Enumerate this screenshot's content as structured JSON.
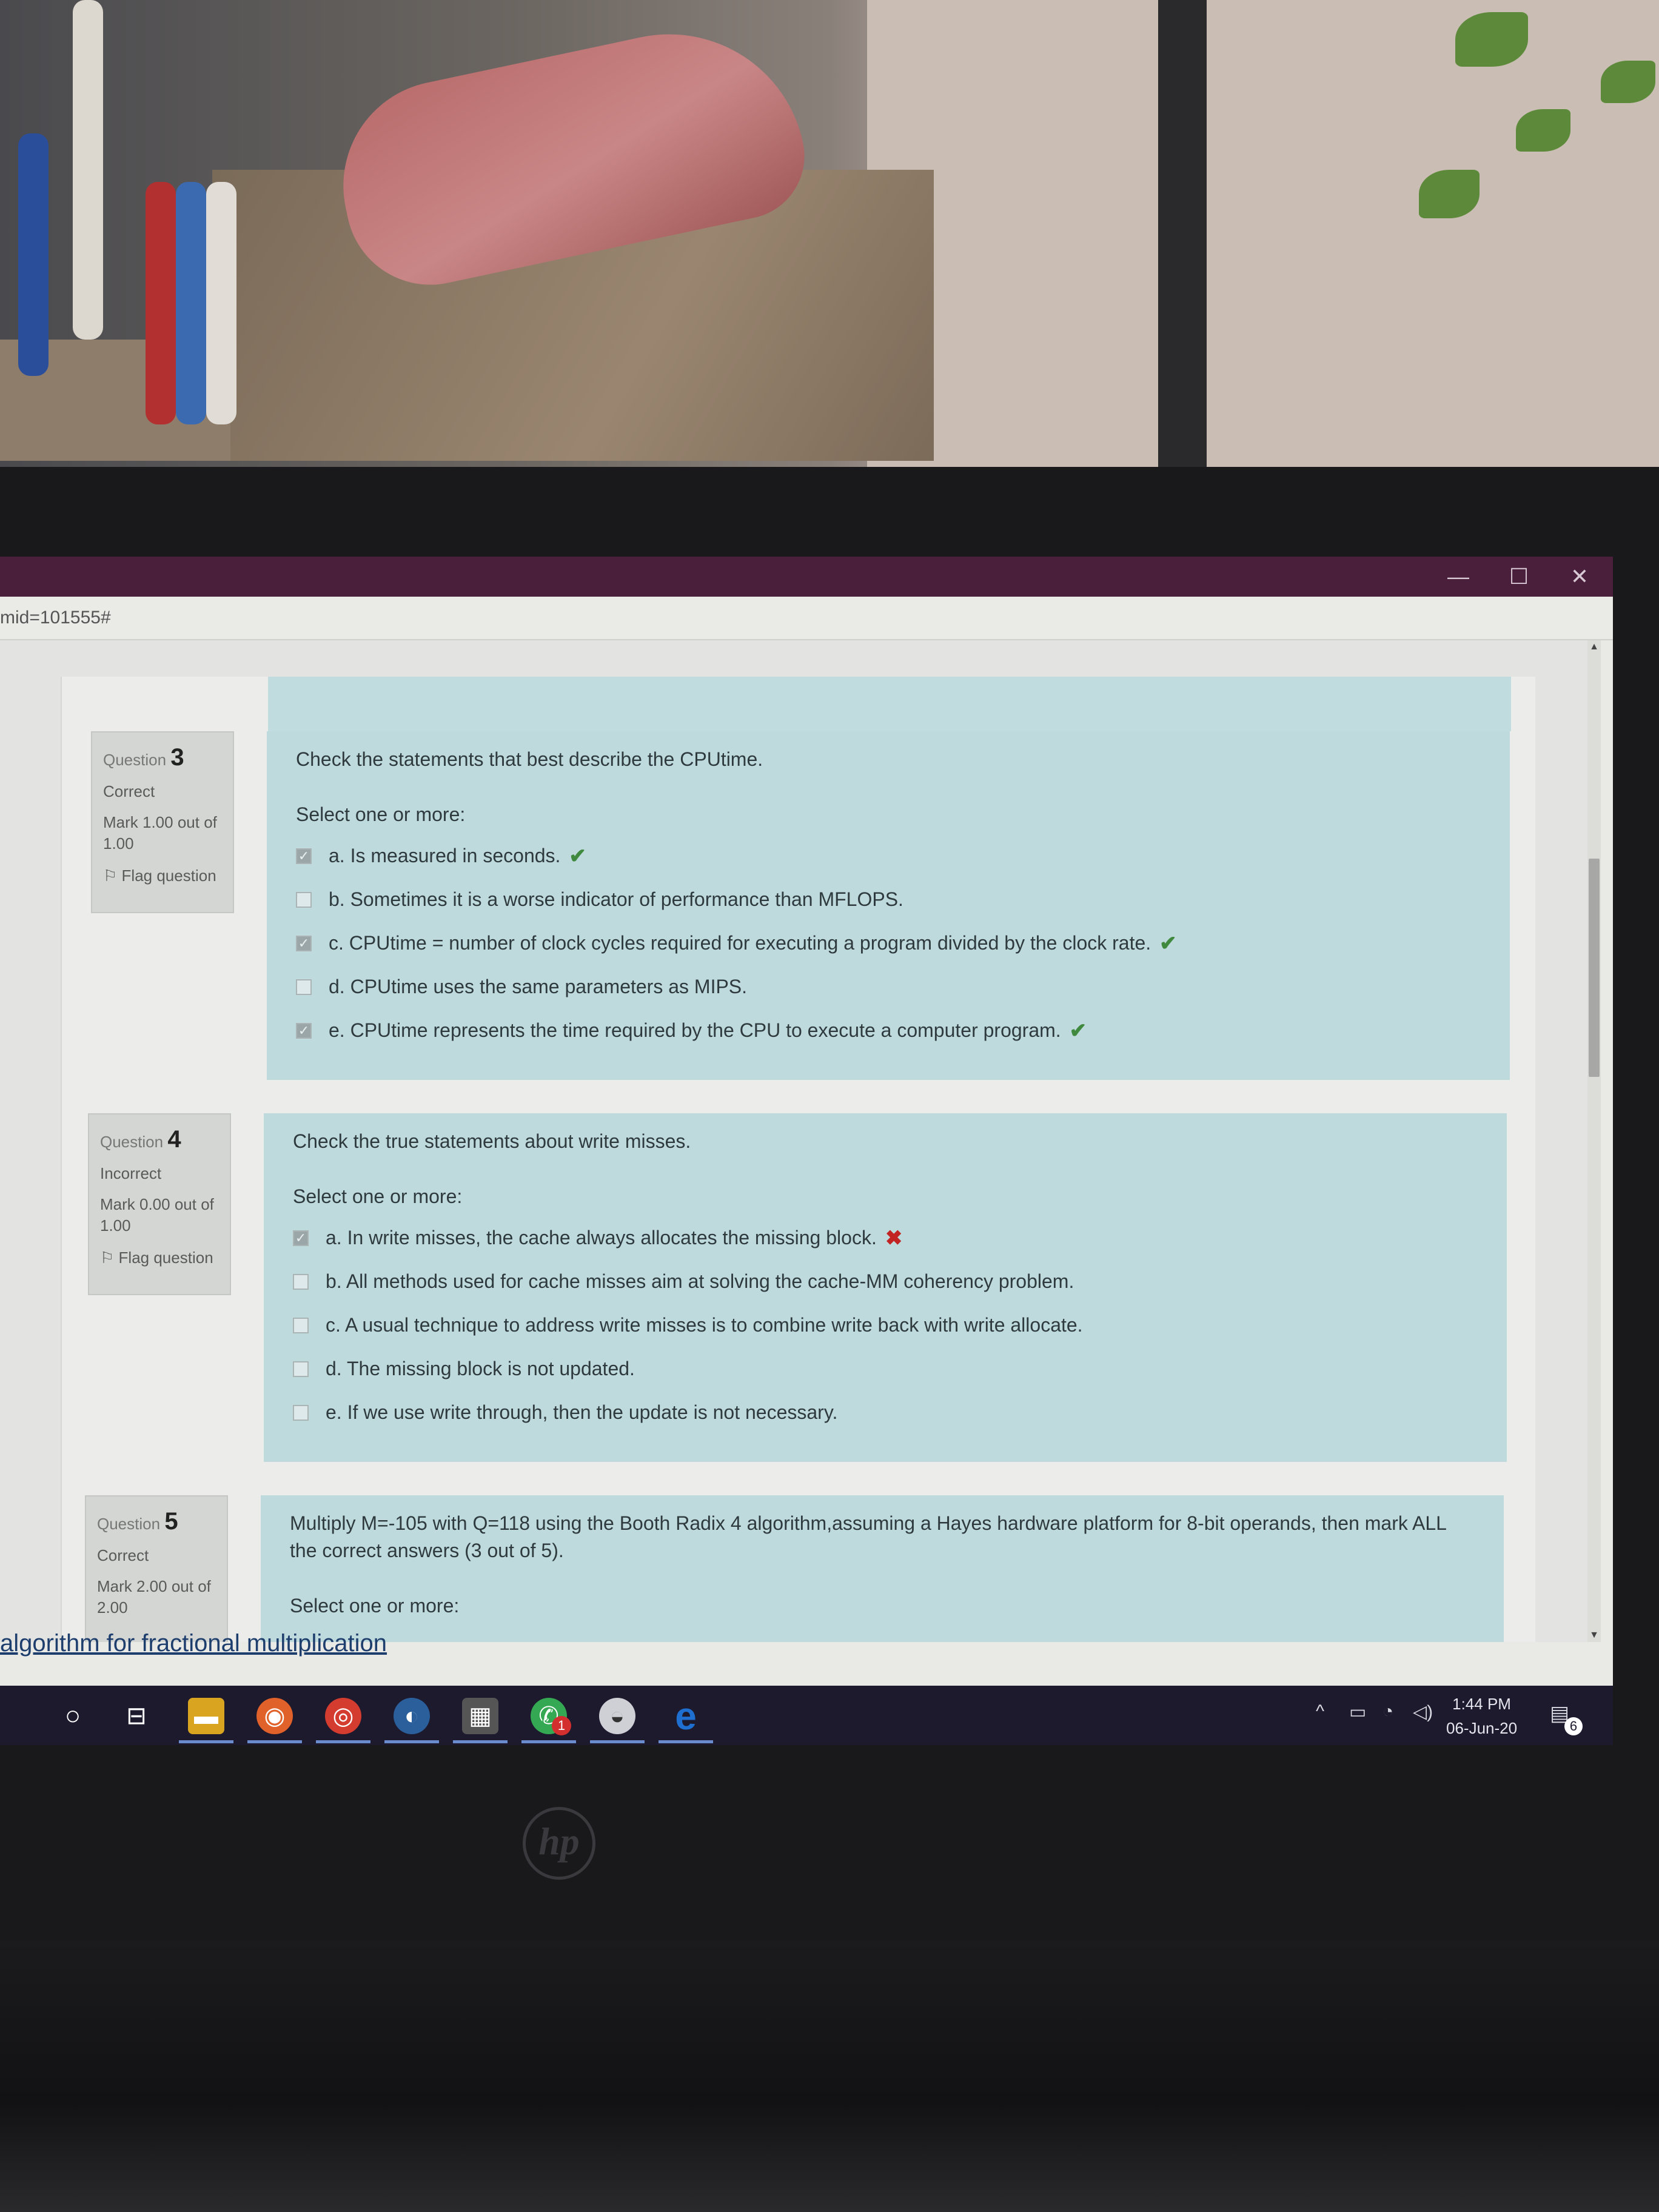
{
  "browser": {
    "address_fragment": "mid=101555#",
    "window_controls": [
      "—",
      "☐",
      "✕"
    ]
  },
  "questions": [
    {
      "number_label": "Question",
      "number": "3",
      "state": "Correct",
      "mark": "Mark 1.00 out of 1.00",
      "flag_label": "Flag question",
      "text": "Check the statements that best describe the CPUtime.",
      "prompt": "Select one or more:",
      "answers": [
        {
          "label": "a. Is measured in seconds.",
          "checked": true,
          "result": "correct"
        },
        {
          "label": "b. Sometimes it is a worse indicator of performance than MFLOPS.",
          "checked": false,
          "result": ""
        },
        {
          "label": "c. CPUtime = number of clock cycles required for executing a program divided by the clock rate.",
          "checked": true,
          "result": "correct"
        },
        {
          "label": "d. CPUtime uses the same parameters as MIPS.",
          "checked": false,
          "result": ""
        },
        {
          "label": "e. CPUtime represents the time required by the CPU to execute a computer program.",
          "checked": true,
          "result": "correct"
        }
      ]
    },
    {
      "number_label": "Question",
      "number": "4",
      "state": "Incorrect",
      "mark": "Mark 0.00 out of 1.00",
      "flag_label": "Flag question",
      "text": "Check the true statements about write misses.",
      "prompt": "Select one or more:",
      "answers": [
        {
          "label": "a. In write misses, the cache always allocates the missing block.",
          "checked": true,
          "result": "incorrect"
        },
        {
          "label": "b. All methods used for cache misses aim at solving the cache-MM coherency problem.",
          "checked": false,
          "result": ""
        },
        {
          "label": "c. A usual technique to address write misses is to combine write back with write allocate.",
          "checked": false,
          "result": ""
        },
        {
          "label": "d. The missing block is not updated.",
          "checked": false,
          "result": ""
        },
        {
          "label": "e. If we use write through, then the update is not necessary.",
          "checked": false,
          "result": ""
        }
      ]
    },
    {
      "number_label": "Question",
      "number": "5",
      "state": "Correct",
      "mark": "Mark 2.00 out of 2.00",
      "flag_label": "",
      "text": "Multiply M=-105 with Q=118 using the Booth Radix 4 algorithm,assuming a Hayes hardware platform for 8-bit operands, then mark ALL the correct answers (3 out of 5).",
      "prompt": "Select one or more:",
      "answers": []
    }
  ],
  "overlay_text": "algorithm for fractional multiplication",
  "icons": {
    "correct": "checkmark-icon",
    "incorrect": "cross-icon",
    "flag": "flag-icon"
  },
  "taskbar": {
    "time": "1:44 PM",
    "date": "06-Jun-20",
    "notification_count": "6",
    "whatsapp_badge": "1"
  },
  "colors": {
    "answer_bg": "#bedadd",
    "correct": "#3f8a3f",
    "incorrect": "#c22424",
    "titlebar": "#4a1f3c",
    "taskbar": "#1d1a2e"
  }
}
